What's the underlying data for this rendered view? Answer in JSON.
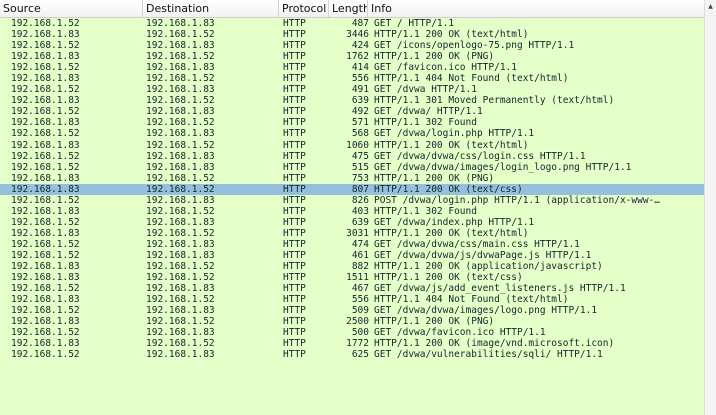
{
  "columns": {
    "source": "Source",
    "destination": "Destination",
    "protocol": "Protocol",
    "length": "Length",
    "info": "Info"
  },
  "colors": {
    "row_bg": "#e4ffc7",
    "selected_bg": "#94bfdd"
  },
  "selected_index": 15,
  "scrollbar": {
    "up_icon": "▲"
  },
  "packets": [
    {
      "src": "192.168.1.52",
      "dst": "192.168.1.83",
      "proto": "HTTP",
      "len": "487",
      "info": "GET / HTTP/1.1"
    },
    {
      "src": "192.168.1.83",
      "dst": "192.168.1.52",
      "proto": "HTTP",
      "len": "3446",
      "info": "HTTP/1.1 200 OK  (text/html)"
    },
    {
      "src": "192.168.1.52",
      "dst": "192.168.1.83",
      "proto": "HTTP",
      "len": "424",
      "info": "GET /icons/openlogo-75.png HTTP/1.1"
    },
    {
      "src": "192.168.1.83",
      "dst": "192.168.1.52",
      "proto": "HTTP",
      "len": "1762",
      "info": "HTTP/1.1 200 OK  (PNG)"
    },
    {
      "src": "192.168.1.52",
      "dst": "192.168.1.83",
      "proto": "HTTP",
      "len": "414",
      "info": "GET /favicon.ico HTTP/1.1"
    },
    {
      "src": "192.168.1.83",
      "dst": "192.168.1.52",
      "proto": "HTTP",
      "len": "556",
      "info": "HTTP/1.1 404 Not Found  (text/html)"
    },
    {
      "src": "192.168.1.52",
      "dst": "192.168.1.83",
      "proto": "HTTP",
      "len": "491",
      "info": "GET /dvwa HTTP/1.1"
    },
    {
      "src": "192.168.1.83",
      "dst": "192.168.1.52",
      "proto": "HTTP",
      "len": "639",
      "info": "HTTP/1.1 301 Moved Permanently  (text/html)"
    },
    {
      "src": "192.168.1.52",
      "dst": "192.168.1.83",
      "proto": "HTTP",
      "len": "492",
      "info": "GET /dvwa/ HTTP/1.1"
    },
    {
      "src": "192.168.1.83",
      "dst": "192.168.1.52",
      "proto": "HTTP",
      "len": "571",
      "info": "HTTP/1.1 302 Found"
    },
    {
      "src": "192.168.1.52",
      "dst": "192.168.1.83",
      "proto": "HTTP",
      "len": "568",
      "info": "GET /dvwa/login.php HTTP/1.1"
    },
    {
      "src": "192.168.1.83",
      "dst": "192.168.1.52",
      "proto": "HTTP",
      "len": "1060",
      "info": "HTTP/1.1 200 OK  (text/html)"
    },
    {
      "src": "192.168.1.52",
      "dst": "192.168.1.83",
      "proto": "HTTP",
      "len": "475",
      "info": "GET /dvwa/dvwa/css/login.css HTTP/1.1"
    },
    {
      "src": "192.168.1.52",
      "dst": "192.168.1.83",
      "proto": "HTTP",
      "len": "515",
      "info": "GET /dvwa/dvwa/images/login_logo.png HTTP/1.1"
    },
    {
      "src": "192.168.1.83",
      "dst": "192.168.1.52",
      "proto": "HTTP",
      "len": "753",
      "info": "HTTP/1.1 200 OK  (PNG)"
    },
    {
      "src": "192.168.1.83",
      "dst": "192.168.1.52",
      "proto": "HTTP",
      "len": "807",
      "info": "HTTP/1.1 200 OK  (text/css)"
    },
    {
      "src": "192.168.1.52",
      "dst": "192.168.1.83",
      "proto": "HTTP",
      "len": "826",
      "info": "POST /dvwa/login.php HTTP/1.1  (application/x-www-…"
    },
    {
      "src": "192.168.1.83",
      "dst": "192.168.1.52",
      "proto": "HTTP",
      "len": "403",
      "info": "HTTP/1.1 302 Found"
    },
    {
      "src": "192.168.1.52",
      "dst": "192.168.1.83",
      "proto": "HTTP",
      "len": "639",
      "info": "GET /dvwa/index.php HTTP/1.1"
    },
    {
      "src": "192.168.1.83",
      "dst": "192.168.1.52",
      "proto": "HTTP",
      "len": "3031",
      "info": "HTTP/1.1 200 OK  (text/html)"
    },
    {
      "src": "192.168.1.52",
      "dst": "192.168.1.83",
      "proto": "HTTP",
      "len": "474",
      "info": "GET /dvwa/dvwa/css/main.css HTTP/1.1"
    },
    {
      "src": "192.168.1.52",
      "dst": "192.168.1.83",
      "proto": "HTTP",
      "len": "461",
      "info": "GET /dvwa/dvwa/js/dvwaPage.js HTTP/1.1"
    },
    {
      "src": "192.168.1.83",
      "dst": "192.168.1.52",
      "proto": "HTTP",
      "len": "882",
      "info": "HTTP/1.1 200 OK  (application/javascript)"
    },
    {
      "src": "192.168.1.83",
      "dst": "192.168.1.52",
      "proto": "HTTP",
      "len": "1511",
      "info": "HTTP/1.1 200 OK  (text/css)"
    },
    {
      "src": "192.168.1.52",
      "dst": "192.168.1.83",
      "proto": "HTTP",
      "len": "467",
      "info": "GET /dvwa/js/add_event_listeners.js HTTP/1.1"
    },
    {
      "src": "192.168.1.83",
      "dst": "192.168.1.52",
      "proto": "HTTP",
      "len": "556",
      "info": "HTTP/1.1 404 Not Found  (text/html)"
    },
    {
      "src": "192.168.1.52",
      "dst": "192.168.1.83",
      "proto": "HTTP",
      "len": "509",
      "info": "GET /dvwa/dvwa/images/logo.png HTTP/1.1"
    },
    {
      "src": "192.168.1.83",
      "dst": "192.168.1.52",
      "proto": "HTTP",
      "len": "2500",
      "info": "HTTP/1.1 200 OK  (PNG)"
    },
    {
      "src": "192.168.1.52",
      "dst": "192.168.1.83",
      "proto": "HTTP",
      "len": "500",
      "info": "GET /dvwa/favicon.ico HTTP/1.1"
    },
    {
      "src": "192.168.1.83",
      "dst": "192.168.1.52",
      "proto": "HTTP",
      "len": "1772",
      "info": "HTTP/1.1 200 OK  (image/vnd.microsoft.icon)"
    },
    {
      "src": "192.168.1.52",
      "dst": "192.168.1.83",
      "proto": "HTTP",
      "len": "625",
      "info": "GET /dvwa/vulnerabilities/sqli/ HTTP/1.1"
    }
  ]
}
